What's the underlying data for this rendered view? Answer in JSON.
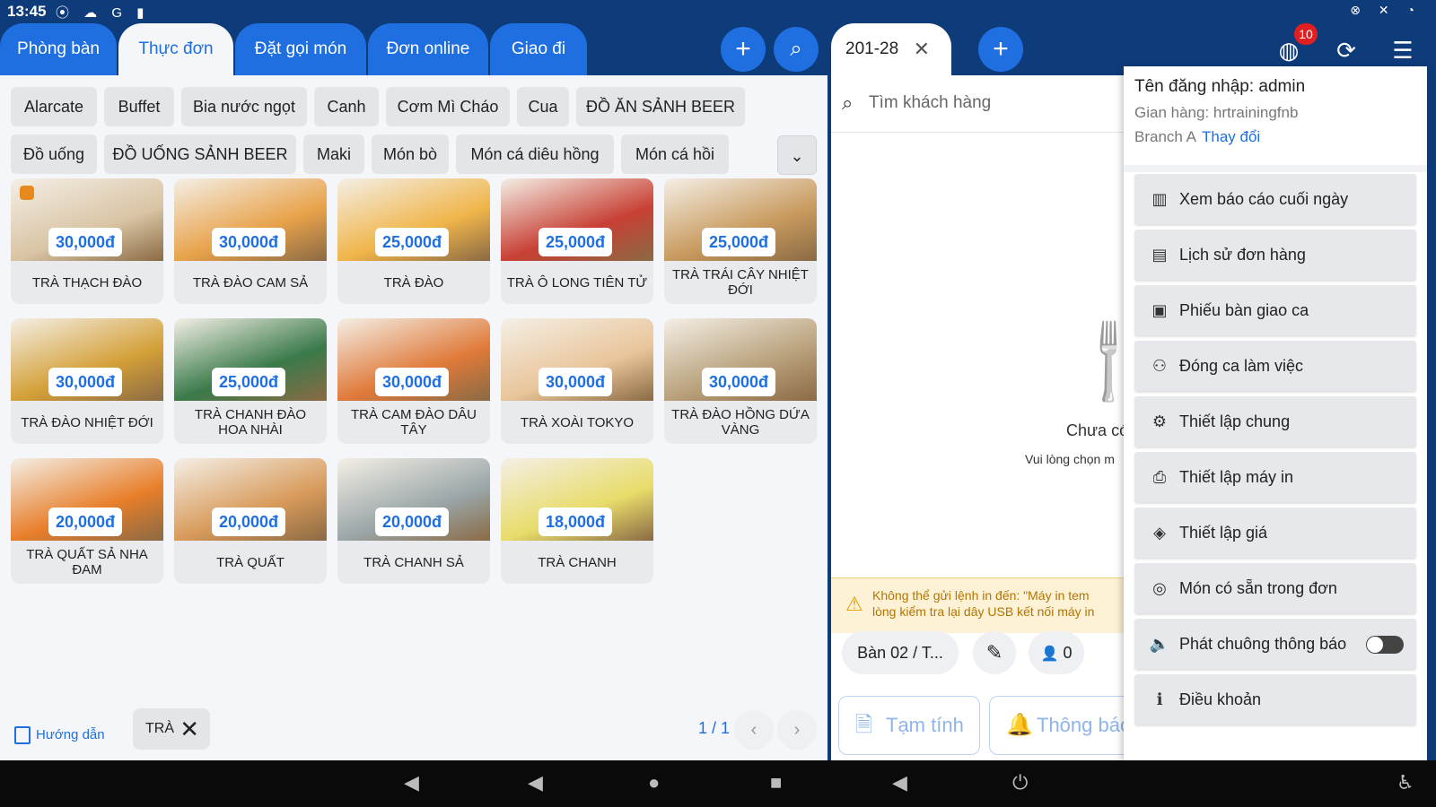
{
  "status": {
    "time": "13:45",
    "left_icons": "⦿ ☁ G ▮",
    "right_icons": "⊗ ✕ ◔"
  },
  "tabs": [
    {
      "label": "Phòng bàn",
      "active": false
    },
    {
      "label": "Thực đơn",
      "active": true
    },
    {
      "label": "Đặt gọi món",
      "active": false
    },
    {
      "label": "Đơn online",
      "active": false
    },
    {
      "label": "Giao đi",
      "active": false
    }
  ],
  "header": {
    "add_icon": "+",
    "search_icon": "⌕",
    "order_tab": "201-28",
    "order_close": "✕",
    "notif_count": "10",
    "globe_icon": "◍",
    "sync_icon": "⟳",
    "menu_icon": "☰"
  },
  "categories": [
    "Alarcate",
    "Buffet",
    "Bia nước ngọt",
    "Canh",
    "Cơm Mì Cháo",
    "Cua",
    "ĐỒ ĂN SẢNH BEER",
    "Đồ uống",
    "ĐỒ UỐNG SẢNH BEER",
    "Maki",
    "Món bò",
    "Món cá diêu hồng",
    "Món cá hồi"
  ],
  "expand_icon": "⌄",
  "products": [
    {
      "name": "TRÀ THẠCH ĐÀO",
      "price": "30,000đ",
      "color": "#d9c4a4"
    },
    {
      "name": "TRÀ ĐÀO CAM SẢ",
      "price": "30,000đ",
      "color": "#e8a24a"
    },
    {
      "name": "TRÀ ĐÀO",
      "price": "25,000đ",
      "color": "#f0b54a"
    },
    {
      "name": "TRÀ Ô LONG TIÊN TỬ",
      "price": "25,000đ",
      "color": "#c84034"
    },
    {
      "name": "TRÀ TRÁI CÂY NHIỆT ĐỚI",
      "price": "25,000đ",
      "color": "#c89a5e"
    },
    {
      "name": "TRÀ ĐÀO NHIỆT ĐỚI",
      "price": "30,000đ",
      "color": "#d4a038"
    },
    {
      "name": "TRÀ CHANH ĐÀO HOA NHÀI",
      "price": "25,000đ",
      "color": "#3a7a4a"
    },
    {
      "name": "TRÀ CAM ĐÀO DÂU TÂY",
      "price": "30,000đ",
      "color": "#e07a3a"
    },
    {
      "name": "TRÀ XOÀI TOKYO",
      "price": "30,000đ",
      "color": "#e9c59a"
    },
    {
      "name": "TRÀ ĐÀO HỒNG DỨA VÀNG",
      "price": "30,000đ",
      "color": "#b8a07a"
    },
    {
      "name": "TRÀ QUẤT SẢ NHA ĐAM",
      "price": "20,000đ",
      "color": "#e87e2a"
    },
    {
      "name": "TRÀ QUẤT",
      "price": "20,000đ",
      "color": "#d89a5a"
    },
    {
      "name": "TRÀ CHANH SẢ",
      "price": "20,000đ",
      "color": "#9aa6a8"
    },
    {
      "name": "TRÀ CHANH",
      "price": "18,000đ",
      "color": "#e8dc6a"
    }
  ],
  "footer": {
    "guide": "Hướng dẫn",
    "filter": "TRÀ",
    "filter_close": "✕",
    "page": "1 / 1",
    "prev": "‹",
    "next": "›"
  },
  "order": {
    "search_placeholder": "Tìm khách hàng",
    "search_icon": "⌕",
    "empty_icon": "🍴",
    "empty_title": "Chưa có",
    "empty_sub": "Vui lòng chọn m",
    "warning_icon": "⚠",
    "warning_line1": "Không thể gửi lệnh in đến: \"Máy in tem",
    "warning_line2": "lòng kiểm tra lại dây USB kết nối máy in",
    "table_label": "Bàn 02 / T...",
    "edit_icon": "✎",
    "guests": "0",
    "guest_icon": "👤",
    "btn_temp": "Tạm tính",
    "btn_temp_icon": "🗎",
    "btn_notify": "Thông báo",
    "btn_notify_icon": "🔔"
  },
  "menu": {
    "username": "Tên đăng nhập: admin",
    "store": "Gian hàng: hrtrainingfnb",
    "branch": "Branch A",
    "change": "Thay đổi",
    "items": [
      {
        "label": "Xem báo cáo cuối ngày",
        "icon": "▥"
      },
      {
        "label": "Lịch sử đơn hàng",
        "icon": "▤"
      },
      {
        "label": "Phiếu bàn giao ca",
        "icon": "▣"
      },
      {
        "label": "Đóng ca làm việc",
        "icon": "⚇"
      },
      {
        "label": "Thiết lập chung",
        "icon": "⚙"
      },
      {
        "label": "Thiết lập máy in",
        "icon": "⎙"
      },
      {
        "label": "Thiết lập giá",
        "icon": "◈"
      },
      {
        "label": "Món có sẵn trong đơn",
        "icon": "◎"
      },
      {
        "label": "Phát chuông thông báo",
        "icon": "🔈"
      },
      {
        "label": "Điều khoản",
        "icon": "ℹ"
      }
    ]
  },
  "navbar": {
    "vol_down": "◀",
    "back": "◀",
    "home": "●",
    "recent": "■",
    "vol_up": "◀",
    "power": "⏻",
    "access": "♿"
  },
  "colors": {
    "brand": "#0e3b7a",
    "accent": "#1f6fe0",
    "warning": "#b37400"
  }
}
